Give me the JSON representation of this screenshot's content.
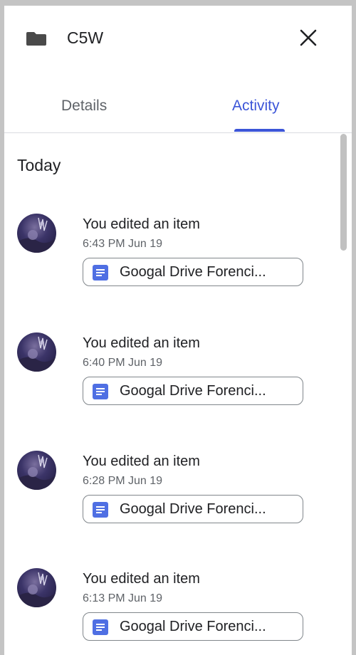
{
  "header": {
    "title": "C5W",
    "folder_icon": "folder-icon",
    "close_icon": "close-icon"
  },
  "tabs": [
    {
      "label": "Details",
      "active": false
    },
    {
      "label": "Activity",
      "active": true
    }
  ],
  "colors": {
    "accent": "#3c55d8",
    "doc_icon": "#4f6fe3"
  },
  "section": {
    "title": "Today"
  },
  "activities": [
    {
      "text": "You edited an item",
      "time": "6:43 PM Jun 19",
      "file": "Googal Drive Forenci..."
    },
    {
      "text": "You edited an item",
      "time": "6:40 PM Jun 19",
      "file": "Googal Drive Forenci..."
    },
    {
      "text": "You edited an item",
      "time": "6:28 PM Jun 19",
      "file": "Googal Drive Forenci..."
    },
    {
      "text": "You edited an item",
      "time": "6:13 PM Jun 19",
      "file": "Googal Drive Forenci..."
    }
  ]
}
